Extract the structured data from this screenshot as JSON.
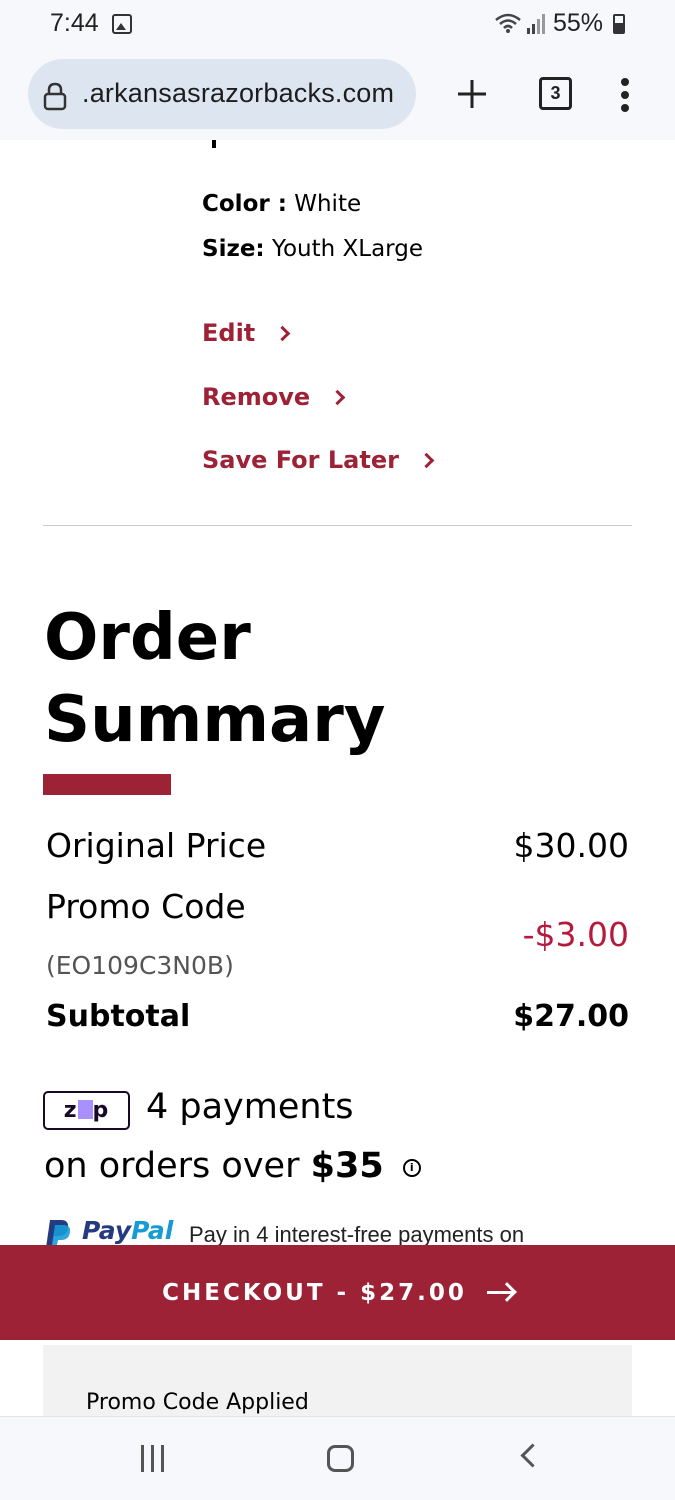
{
  "status_bar": {
    "time": "7:44",
    "battery": "55%"
  },
  "browser": {
    "url": ".arkansasrazorbacks.com",
    "tab_count": "3"
  },
  "cart_item": {
    "color_label": "Color :",
    "color_value": "White",
    "size_label": "Size:",
    "size_value": "Youth XLarge",
    "actions": {
      "edit": "Edit",
      "remove": "Remove",
      "save_for_later": "Save For Later"
    }
  },
  "order_summary": {
    "title": "Order Summary",
    "original_price_label": "Original Price",
    "original_price_value": "$30.00",
    "promo_label": "Promo Code",
    "promo_code": "(EO109C3N0B)",
    "promo_value": "-$3.00",
    "subtotal_label": "Subtotal",
    "subtotal_value": "$27.00"
  },
  "zip": {
    "logo_text": "zip",
    "line1": "4 payments",
    "line2_prefix": "on orders over",
    "threshold": "$35"
  },
  "paypal": {
    "brand_pay": "Pay",
    "brand_pal": "Pal",
    "text": "Pay in 4 interest-free payments on"
  },
  "checkout": {
    "label": "CHECKOUT - $27.00"
  },
  "promo_panel": {
    "text": "Promo Code Applied"
  },
  "colors": {
    "brand": "#9d2235",
    "discount": "#b7193c"
  },
  "icons": [
    "gallery-icon",
    "wifi-icon",
    "signal-icon",
    "battery-icon",
    "lock-icon",
    "plus-icon",
    "tabs-icon",
    "menu-icon",
    "chevron-right-icon",
    "info-icon",
    "arrow-right-icon",
    "recents-icon",
    "home-icon",
    "back-icon"
  ]
}
